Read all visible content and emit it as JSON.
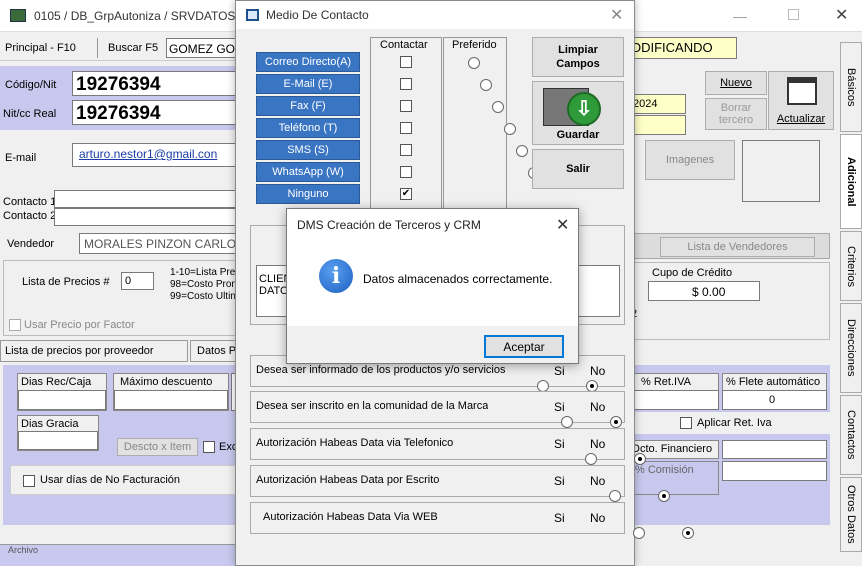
{
  "main_window": {
    "title": "0105 / DB_GrpAutoniza / SRVDATOS",
    "principal_label": "Principal - F10",
    "buscar_label": "Buscar F5",
    "buscar_value": "GOMEZ GO",
    "codigo_label": "Código/Nit",
    "codigo_value": "19276394",
    "nitcc_label": "Nit/cc Real",
    "nitcc_value": "19276394",
    "email_label": "E-mail",
    "email_value": "arturo.nestor1@gmail.con",
    "contacto1_label": "Contacto 1",
    "contacto2_label": "Contacto 2",
    "vendedor_label": "Vendedor",
    "vendedor_value": "MORALES PINZON CARLO",
    "lista_precios_label": "Lista de Precios #",
    "lista_precios_value": "0",
    "lista_hint_1": "1-10=Lista Pre",
    "lista_hint_2": "98=Costo Pror",
    "lista_hint_3": "99=Costo Ultin",
    "usar_precio_factor": "Usar Precio por Factor",
    "lista_proveedor_tab": "Lista de precios por proveedor",
    "datos_tab": "Datos Pr",
    "dias_rec_label": "Dias Rec/Caja",
    "maximo_desc_label": "Máximo descuento",
    "dias_gracia_label": "Dias Gracia",
    "descto_item": "Descto x Item",
    "excl_label": "Excl",
    "usar_dias_label": "Usar días de No Facturación",
    "modificando": "ODIFICANDO",
    "fecha_value": "2024",
    "nuevo": "Nuevo",
    "borrar": "Borrar",
    "tercero": "tercero",
    "actualizar": "Actualizar",
    "imagenes": "Imagenes",
    "lista_vendedores": "Lista de Vendedores",
    "cupo_credito_label": "Cupo de Crédito",
    "cupo_credito_value": "$ 0.00",
    "digit_2": "2",
    "ret_iva_label": "% Ret.IVA",
    "flete_label": "% Flete automático",
    "flete_value": "0",
    "aplicar_ret_iva": "Aplicar Ret. Iva",
    "dcto_financiero": "Dcto. Financiero",
    "comision": "% Comisión",
    "side_tabs": [
      "Básicos",
      "Adicional",
      "Criterios",
      "Direcciones",
      "Contactos",
      "Otros Datos"
    ],
    "bottom_text": "Archivo"
  },
  "medio_dialog": {
    "title": "Medio De Contacto",
    "col_contactar": "Contactar",
    "col_preferido": "Preferido",
    "channels": [
      {
        "label": "Correo Directo(A)",
        "contactar": false
      },
      {
        "label": "E-Mail (E)",
        "contactar": false
      },
      {
        "label": "Fax (F)",
        "contactar": false
      },
      {
        "label": "Teléfono (T)",
        "contactar": false
      },
      {
        "label": "SMS (S)",
        "contactar": false
      },
      {
        "label": "WhatsApp (W)",
        "contactar": false
      },
      {
        "label": "Ninguno",
        "contactar": true
      }
    ],
    "limpiar": "Limpiar Campos",
    "guardar": "Guardar",
    "salir": "Salir",
    "cliente_text_1": "CLIEN",
    "cliente_text_2": "DATO!",
    "q1": "Desea ser informado de los productos y/o servicios",
    "q2": "Desea ser inscrito en la comunidad de la Marca",
    "q3": "Autorización Habeas Data via Telefonico",
    "q4": "Autorización Habeas Data por Escrito",
    "q5": "Autorización Habeas Data Via WEB",
    "si": "Si",
    "no": "No"
  },
  "msgbox": {
    "title": "DMS Creación de Terceros y CRM",
    "message": "Datos almacenados correctamente.",
    "ok": "Aceptar"
  }
}
